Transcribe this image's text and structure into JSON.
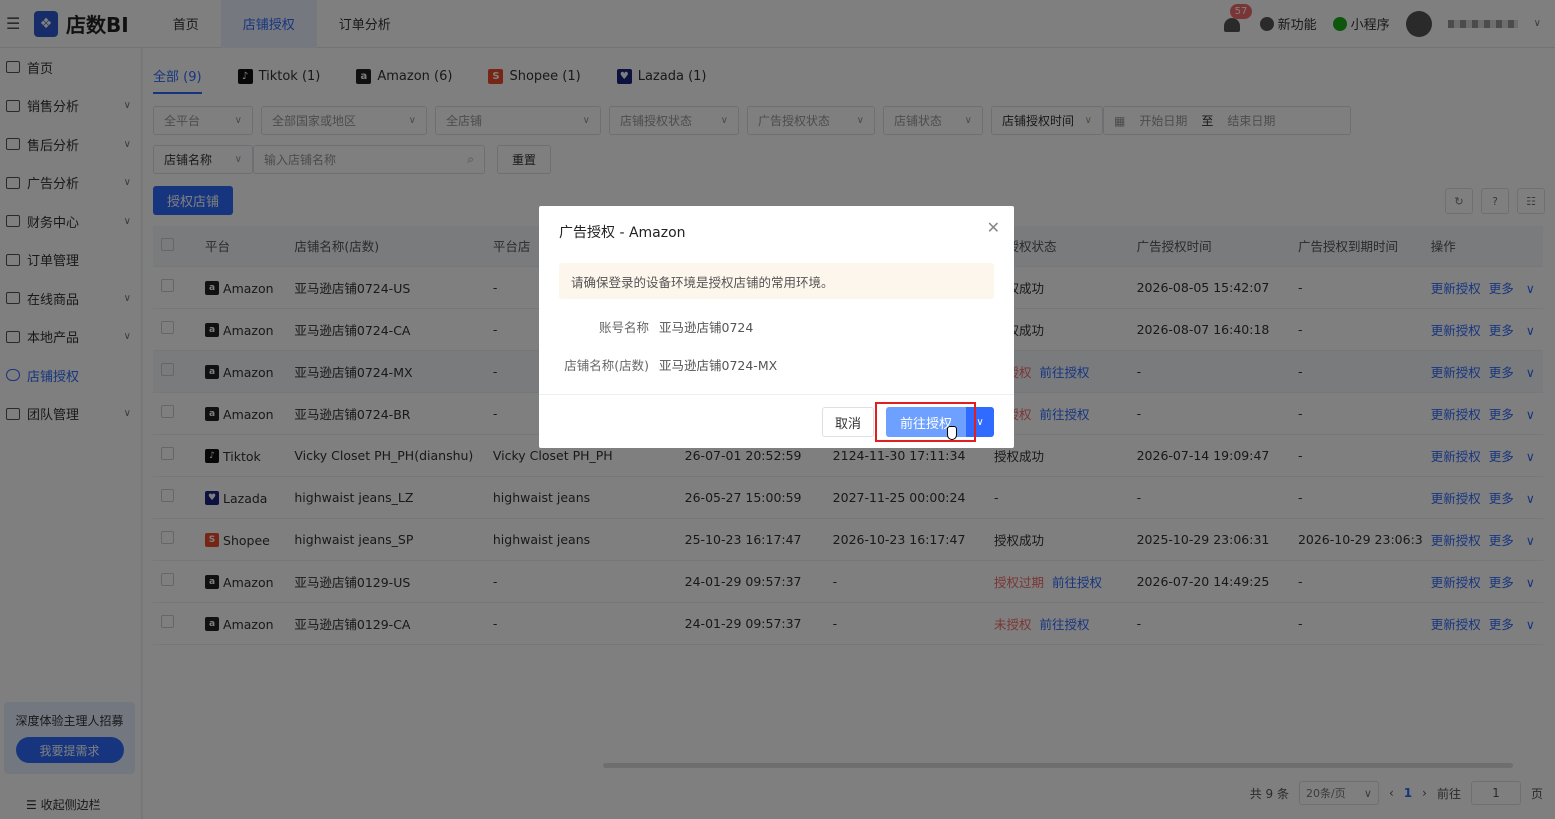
{
  "app": {
    "name": "店数BI"
  },
  "topnav": [
    {
      "label": "首页"
    },
    {
      "label": "店铺授权"
    },
    {
      "label": "订单分析"
    }
  ],
  "header_right": {
    "badge_count": "57",
    "new_features": "新功能",
    "mini_program": "小程序"
  },
  "sidebar": {
    "items": [
      {
        "label": "首页",
        "chevron": ""
      },
      {
        "label": "销售分析",
        "chevron": "∨"
      },
      {
        "label": "售后分析",
        "chevron": "∨"
      },
      {
        "label": "广告分析",
        "chevron": "∨"
      },
      {
        "label": "财务中心",
        "chevron": "∨"
      },
      {
        "label": "订单管理",
        "chevron": ""
      },
      {
        "label": "在线商品",
        "chevron": "∨"
      },
      {
        "label": "本地产品",
        "chevron": "∨"
      },
      {
        "label": "店铺授权",
        "chevron": ""
      },
      {
        "label": "团队管理",
        "chevron": "∨"
      }
    ],
    "promo_text": "深度体验主理人招募",
    "promo_button": "我要提需求",
    "collapse": "收起侧边栏"
  },
  "tabs": [
    {
      "label": "全部 (9)",
      "icon": ""
    },
    {
      "label": "Tiktok (1)",
      "icon": "tiktok-icon"
    },
    {
      "label": "Amazon (6)",
      "icon": "amazon-icon"
    },
    {
      "label": "Shopee (1)",
      "icon": "shopee-icon"
    },
    {
      "label": "Lazada (1)",
      "icon": "lazada-icon"
    }
  ],
  "filters": {
    "platform": "全平台",
    "country": "全部国家或地区",
    "store": "全店铺",
    "store_auth_status": "店铺授权状态",
    "ad_auth_status": "广告授权状态",
    "store_status": "店铺状态",
    "store_auth_time": "店铺授权时间",
    "start_date": "开始日期",
    "to": "至",
    "end_date": "结束日期",
    "name_type": "店铺名称",
    "name_placeholder": "输入店铺名称",
    "reset": "重置"
  },
  "auth_store_button": "授权店铺",
  "table": {
    "headers": [
      "平台",
      "店铺名称(店数)",
      "平台店",
      "告授权状态",
      "广告授权时间",
      "广告授权到期时间",
      "操作"
    ],
    "rows": [
      {
        "platform": "Amazon",
        "store": "亚马逊店铺0724-US",
        "pstore": "-",
        "c1": "",
        "c2": "",
        "ad_status": "授权成功",
        "ad_link": "",
        "ad_time": "2026-08-05 15:42:07",
        "ad_expire": "-"
      },
      {
        "platform": "Amazon",
        "store": "亚马逊店铺0724-CA",
        "pstore": "-",
        "c1": "",
        "c2": "",
        "ad_status": "授权成功",
        "ad_link": "",
        "ad_time": "2026-08-07 16:40:18",
        "ad_expire": "-"
      },
      {
        "platform": "Amazon",
        "store": "亚马逊店铺0724-MX",
        "pstore": "-",
        "c1": "",
        "c2": "",
        "ad_status": "未授权",
        "ad_link": "前往授权",
        "ad_time": "-",
        "ad_expire": "-"
      },
      {
        "platform": "Amazon",
        "store": "亚马逊店铺0724-BR",
        "pstore": "-",
        "c1": "",
        "c2": "",
        "ad_status": "未授权",
        "ad_link": "前往授权",
        "ad_time": "-",
        "ad_expire": "-"
      },
      {
        "platform": "Tiktok",
        "store": "Vicky Closet PH_PH(dianshu)",
        "pstore": "Vicky Closet PH_PH",
        "c1": "26-07-01 20:52:59",
        "c2": "2124-11-30 17:11:34",
        "ad_status": "授权成功",
        "ad_link": "",
        "ad_time": "2026-07-14 19:09:47",
        "ad_expire": "-"
      },
      {
        "platform": "Lazada",
        "store": "highwaist jeans_LZ",
        "pstore": "highwaist jeans",
        "c1": "26-05-27 15:00:59",
        "c2": "2027-11-25 00:00:24",
        "ad_status": "-",
        "ad_link": "",
        "ad_time": "-",
        "ad_expire": "-"
      },
      {
        "platform": "Shopee",
        "store": "highwaist jeans_SP",
        "pstore": "highwaist jeans",
        "c1": "25-10-23 16:17:47",
        "c2": "2026-10-23 16:17:47",
        "ad_status": "授权成功",
        "ad_link": "",
        "ad_time": "2025-10-29 23:06:31",
        "ad_expire": "2026-10-29 23:06:3"
      },
      {
        "platform": "Amazon",
        "store": "亚马逊店铺0129-US",
        "pstore": "-",
        "c1": "24-01-29 09:57:37",
        "c2": "-",
        "ad_status": "授权过期",
        "ad_link": "前往授权",
        "ad_time": "2026-07-20 14:49:25",
        "ad_expire": "-"
      },
      {
        "platform": "Amazon",
        "store": "亚马逊店铺0129-CA",
        "pstore": "-",
        "c1": "24-01-29 09:57:37",
        "c2": "-",
        "ad_status": "未授权",
        "ad_link": "前往授权",
        "ad_time": "-",
        "ad_expire": "-"
      }
    ],
    "op_update": "更新授权",
    "op_more": "更多"
  },
  "pager": {
    "total": "共 9 条",
    "page_size": "20条/页",
    "current": "1",
    "goto": "前往",
    "goto_value": "1",
    "page_unit": "页"
  },
  "dialog": {
    "title": "广告授权 - Amazon",
    "notice": "请确保登录的设备环境是授权店铺的常用环境。",
    "account_label": "账号名称",
    "account_value": "亚马逊店铺0724",
    "store_label": "店铺名称(店数)",
    "store_value": "亚马逊店铺0724-MX",
    "cancel": "取消",
    "go": "前往授权"
  },
  "colors": {
    "primary": "#2f6bff",
    "danger": "#f56c6c",
    "amazon": "#222222",
    "tiktok": "#111111",
    "shopee": "#ee4d2d",
    "lazada": "#1a237e"
  }
}
